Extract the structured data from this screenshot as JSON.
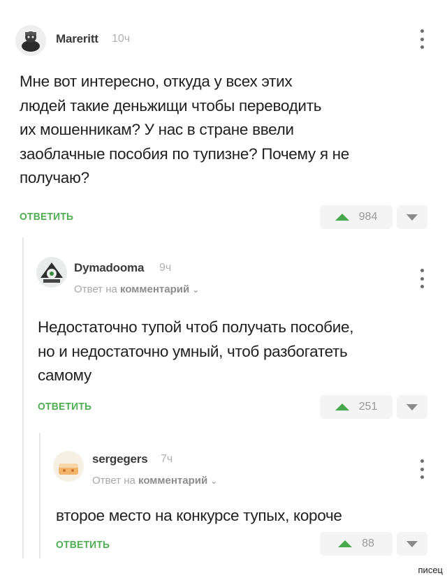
{
  "comments": [
    {
      "author": "Mareritt",
      "time": "10ч",
      "lines": [
        "Мне вот интересно, откуда у всех этих",
        "людей такие деньжищи чтобы переводить",
        "их мошенникам? У нас в стране ввели",
        "заоблачные пособия по тупизне? Почему я не",
        "получаю?"
      ],
      "reply_label": "ОТВЕТИТЬ",
      "votes": "984"
    },
    {
      "author": "Dymadooma",
      "time": "9ч",
      "reply_prefix": "Ответ на",
      "reply_target": "комментарий",
      "lines": [
        "Недостаточно тупой чтоб получать пособие,",
        "но и недостаточно умный, чтоб разбогатеть",
        "самому"
      ],
      "reply_label": "ОТВЕТИТЬ",
      "votes": "251"
    },
    {
      "author": "sergegers",
      "time": "7ч",
      "reply_prefix": "Ответ на",
      "reply_target": "комментарий",
      "lines": [
        "второе место на конкурсе тупых, короче"
      ],
      "reply_label": "ОТВЕТИТЬ",
      "votes": "88"
    }
  ],
  "watermark": "писец",
  "icons": {
    "menu": "more-vertical-icon",
    "upvote": "triangle-up-icon",
    "downvote": "triangle-down-icon",
    "reply_chevron": "chevron-down-icon"
  },
  "colors": {
    "accent": "#4fae52",
    "upvote": "#48a84c",
    "muted": "#a8a8a8"
  }
}
